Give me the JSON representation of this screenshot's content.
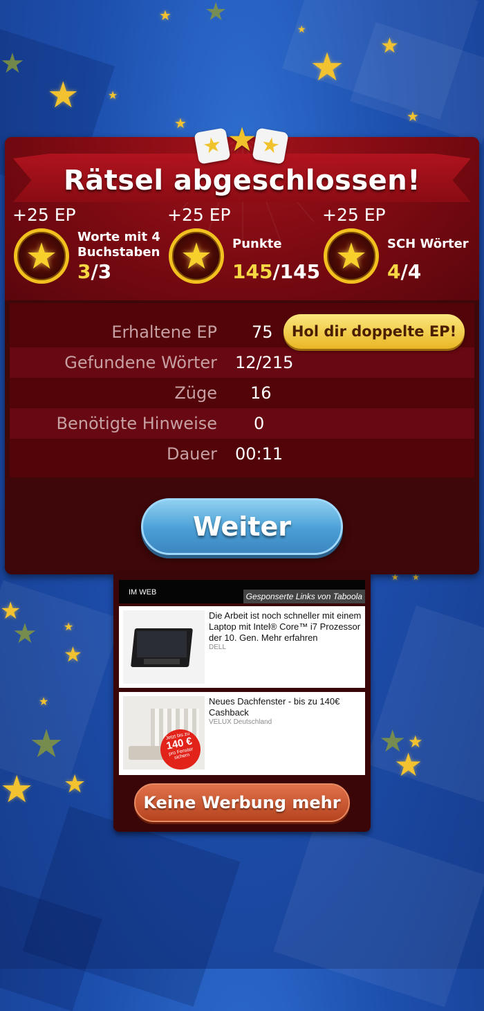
{
  "title": "Rätsel abgeschlossen!",
  "goals": [
    {
      "ep": "+25 EP",
      "name_line1": "Worte mit 4",
      "name_line2": "Buchstaben",
      "progress_done": "3",
      "progress_total": "/3"
    },
    {
      "ep": "+25 EP",
      "name_line1": "Punkte",
      "name_line2": "",
      "progress_done": "145",
      "progress_total": "/145"
    },
    {
      "ep": "+25 EP",
      "name_line1": "SCH Wörter",
      "name_line2": "",
      "progress_done": "4",
      "progress_total": "/4"
    }
  ],
  "stats": [
    {
      "label": "Erhaltene EP",
      "value": "75"
    },
    {
      "label": "Gefundene Wörter",
      "value": "12/215"
    },
    {
      "label": "Züge",
      "value": "16"
    },
    {
      "label": "Benötigte Hinweise",
      "value": "0"
    },
    {
      "label": "Dauer",
      "value": "00:11"
    }
  ],
  "double_ep_button": "Hol dir doppelte EP!",
  "continue_button": "Weiter",
  "ads": {
    "header": "IM WEB",
    "sponsored": "Gesponserte Links von Taboola",
    "items": [
      {
        "text": "Die Arbeit ist noch schneller mit einem Laptop mit Intel® Core™ i7 Prozessor der 10. Gen. Mehr erfahren",
        "source": "DELL"
      },
      {
        "text": "Neues Dachfenster - bis zu 140€ Cashback",
        "source": "VELUX Deutschland",
        "badge_line1": "Jetzt bis zu",
        "badge_amount": "140 €",
        "badge_line2": "pro Fenster",
        "badge_line3": "sichern"
      }
    ]
  },
  "no_ads_button": "Keine Werbung mehr",
  "colors": {
    "gold": "#f7d744",
    "panel": "#3e0709",
    "blue_button": "#4a9fd6",
    "orange_button": "#b5441f"
  }
}
